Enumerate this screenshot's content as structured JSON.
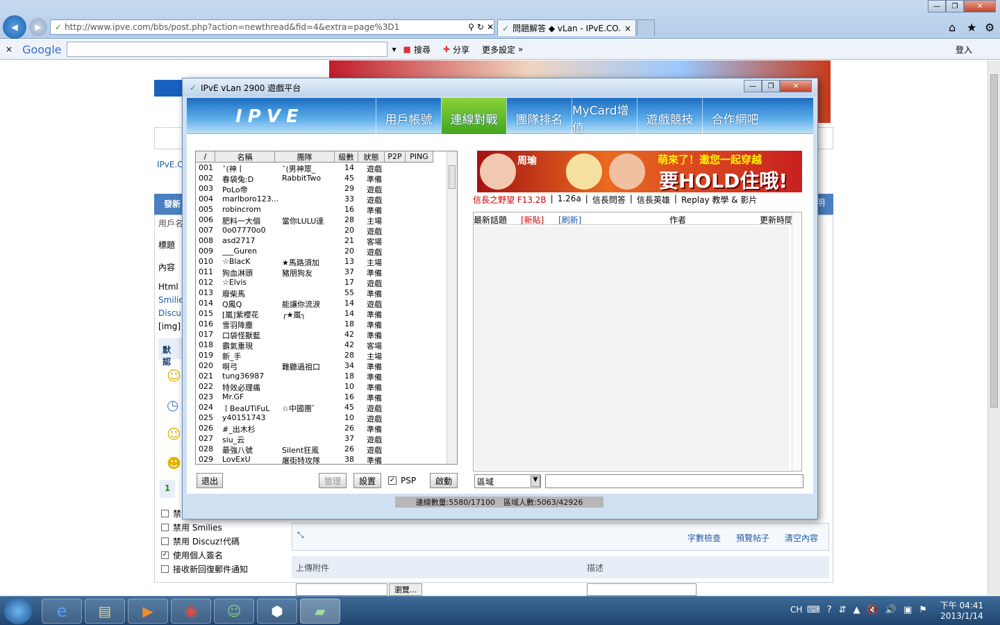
{
  "browser": {
    "url": "http://www.ipve.com/bbs/post.php?action=newthread&fid=4&extra=page%3D1",
    "tab_title": "問題解答 ◆ vLan - IPvE.CO...",
    "google_label": "Google",
    "search_btn": "搜尋",
    "share_btn": "分享",
    "more_settings": "更多設定",
    "login": "登入"
  },
  "forum_bg": {
    "site_crumb": "IPvE.C",
    "section_post": "發新",
    "field_user": "用戶名",
    "field_title": "標題",
    "field_content": "內容",
    "html_label": "Html",
    "smilies": "Smilie",
    "discuz": "Discu",
    "img": "[img]",
    "default_smilies": "默認",
    "page_num": "1",
    "checkboxes": [
      {
        "label": "禁",
        "checked": false
      },
      {
        "label": "禁用 Smilies",
        "checked": false
      },
      {
        "label": "禁用 Discuz!代碼",
        "checked": false
      },
      {
        "label": "使用個人簽名",
        "checked": true
      },
      {
        "label": "接收新回復郵件通知",
        "checked": false
      }
    ],
    "editor_links": [
      "字數檢查",
      "預覽帖子",
      "清空內容"
    ],
    "upload_label": "上傳附件",
    "desc_label": "描述",
    "browse_btn": "瀏覽...",
    "right_side": "明"
  },
  "vlan": {
    "window_title": "IPvE vLan 2900 遊戲平台",
    "logo": "IPVE",
    "nav": [
      {
        "label": "用戶帳號",
        "active": false
      },
      {
        "label": "連線對戰",
        "active": true
      },
      {
        "label": "團隊排名",
        "active": false
      },
      {
        "label": "MyCard增值",
        "active": false
      },
      {
        "label": "遊戲競技",
        "active": false
      },
      {
        "label": "合作網吧",
        "active": false
      }
    ],
    "columns": [
      "/",
      "名稱",
      "團隊",
      "級數",
      "狀態",
      "P2P",
      "PING"
    ],
    "players": [
      [
        "001",
        "ˇ(神丨",
        "ˇ(男神眾_",
        "14",
        "遊戲"
      ],
      [
        "002",
        "春袋兔:D",
        "RabbitTwo",
        "45",
        "準備"
      ],
      [
        "003",
        "PoLo帝",
        "",
        "29",
        "遊戲"
      ],
      [
        "004",
        "marlboro123...",
        "",
        "33",
        "遊戲"
      ],
      [
        "005",
        "robincrom",
        "",
        "16",
        "準備"
      ],
      [
        "006",
        "肥料一大個",
        "當你LULU達",
        "28",
        "主場"
      ],
      [
        "007",
        "0o07770o0",
        "",
        "20",
        "遊戲"
      ],
      [
        "008",
        "asd2717",
        "",
        "21",
        "客場"
      ],
      [
        "009",
        "___Guren",
        "",
        "20",
        "遊戲"
      ],
      [
        "010",
        "☆BlacK",
        "★馬路須加",
        "13",
        "主場"
      ],
      [
        "011",
        "狗血淋頭",
        "豬朋狗友",
        "37",
        "準備"
      ],
      [
        "012",
        "☆Elvis",
        "",
        "17",
        "遊戲"
      ],
      [
        "013",
        "廢柴馬",
        "",
        "55",
        "準備"
      ],
      [
        "014",
        "Q鳳Q",
        "能讓你流淚",
        "14",
        "遊戲"
      ],
      [
        "015",
        "[嵐]紫櫻花",
        "╭★嵐╮",
        "14",
        "準備"
      ],
      [
        "016",
        "雪羽降塵",
        "",
        "18",
        "準備"
      ],
      [
        "017",
        "口袋怪獸藍",
        "",
        "42",
        "準備"
      ],
      [
        "018",
        "霸氣重現",
        "",
        "42",
        "客場"
      ],
      [
        "019",
        "新_手",
        "",
        "28",
        "主場"
      ],
      [
        "020",
        "啊弓",
        "難聽過祖口",
        "34",
        "準備"
      ],
      [
        "021",
        "tung36987",
        "",
        "18",
        "準備"
      ],
      [
        "022",
        "特效必理痛",
        "",
        "10",
        "準備"
      ],
      [
        "023",
        "Mr.GF",
        "",
        "16",
        "準備"
      ],
      [
        "024",
        "丨BeaUTiFuL",
        "☆中國團゛",
        "45",
        "遊戲"
      ],
      [
        "025",
        "y40151743",
        "",
        "10",
        "遊戲"
      ],
      [
        "026",
        "#_出木杉",
        "",
        "26",
        "準備"
      ],
      [
        "027",
        "siu_云",
        "",
        "37",
        "遊戲"
      ],
      [
        "028",
        "最強八號",
        "Silent狂風",
        "26",
        "遊戲"
      ],
      [
        "029",
        "LovExU",
        "屠街特攻隊",
        "38",
        "準備"
      ]
    ],
    "buttons": {
      "exit": "退出",
      "manage": "管理",
      "settings": "設置",
      "psp": "PSP",
      "psp_checked": true,
      "start": "啟動"
    },
    "banner_top": "萌來了！邀您一起穿越",
    "banner_big": "要HOLD住哦!",
    "banner_left": "周瑜",
    "links": [
      "信長之野望 F13.2B",
      "1.26a",
      "信長問答",
      "信長英雄",
      "Replay 教學 & 影片"
    ],
    "topic_headers": {
      "latest": "最新話題",
      "new": "[新貼]",
      "refresh": "[刷新]",
      "author": "作者",
      "updated": "更新時間"
    },
    "region_select": "區域",
    "status": {
      "connections": "連線數量:5580/17100",
      "region": "區域人數:5063/42926"
    }
  },
  "taskbar": {
    "ime": "CH",
    "time": "下午 04:41",
    "date": "2013/1/14"
  }
}
